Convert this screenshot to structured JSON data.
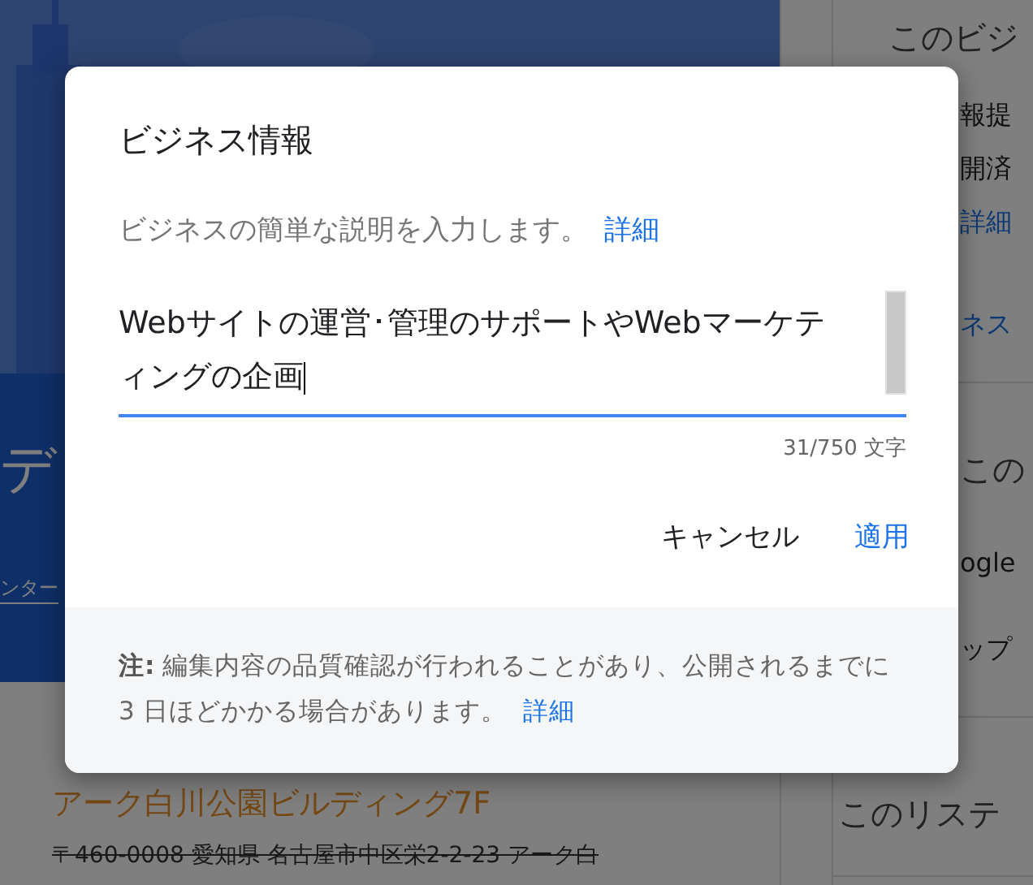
{
  "background": {
    "banner": {
      "kind": "picture",
      "heading": "デ",
      "subheading": "ンター"
    },
    "listing": {
      "name": "アーク白川公園ビルディング7F",
      "address_lines": [
        "〒460-0008 愛知県 名古屋市中区栄2-2-23 アーク白"
      ]
    },
    "side_panel": {
      "sections": [
        {
          "lines": [
            {
              "text": "このビジ",
              "kind": "heading"
            },
            {
              "text": "報提",
              "kind": "text"
            },
            {
              "text": "開済",
              "kind": "text"
            },
            {
              "text": "詳細",
              "kind": "link"
            },
            {
              "text": "ネス",
              "kind": "link"
            }
          ]
        },
        {
          "lines": [
            {
              "text": "この",
              "kind": "heading"
            },
            {
              "text": "ogle",
              "kind": "text"
            },
            {
              "text": "ップ",
              "kind": "text"
            }
          ]
        },
        {
          "lines": [
            {
              "text": "このリステ",
              "kind": "heading"
            }
          ]
        }
      ]
    }
  },
  "dialog": {
    "title": "ビジネス情報",
    "description": "ビジネスの簡単な説明を入力します。",
    "description_link": "詳細",
    "field": {
      "value": "Webサイトの運営･管理のサポートやWebマーケティングの企画",
      "counter": "31/750 文字",
      "focused": true
    },
    "buttons": [
      {
        "label": "キャンセル",
        "kind": "plain"
      },
      {
        "label": "適用",
        "kind": "primary"
      }
    ],
    "footer": {
      "note": "**注:** 編集内容の品質確認が行われることがあり、公開されるまでに 3 日ほどかかる場合があります。",
      "link": "詳細"
    }
  }
}
